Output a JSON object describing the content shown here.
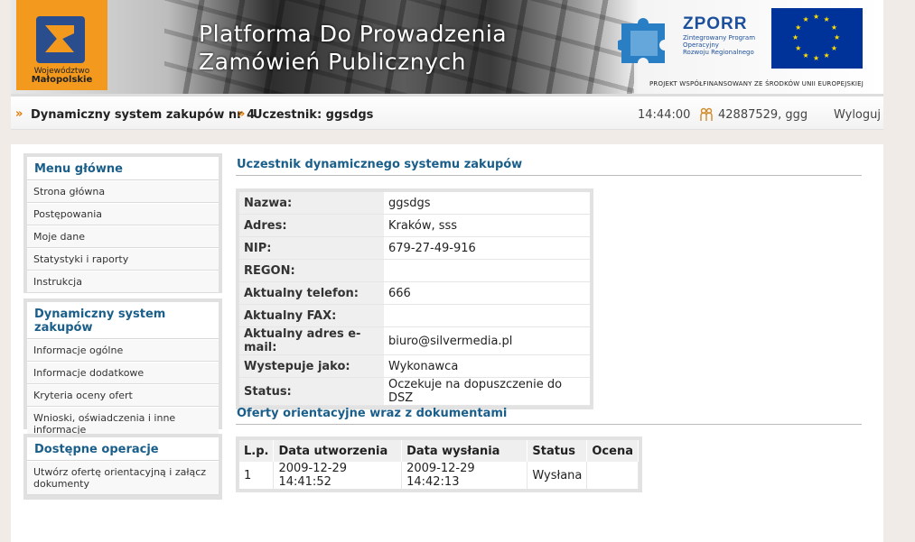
{
  "header": {
    "region_logo": {
      "line1": "Województwo",
      "line2": "Małopolskie"
    },
    "title_line1": "Platforma Do Prowadzenia",
    "title_line2": "Zamówień Publicznych",
    "zporr": {
      "name": "ZPORR",
      "line1": "Zintegrowany Program",
      "line2": "Operacyjny",
      "line3": "Rozwoju Regionalnego"
    },
    "project_note": "PROJEKT WSPÓŁFINANSOWANY ZE ŚRODKÓW UNII EUROPEJSKIEJ",
    "accent_color": "#f39a1e",
    "eu_flag_color": "#003399"
  },
  "navbar": {
    "breadcrumb_sep": "»",
    "crumb1": "Dynamiczny system zakupów nr 4",
    "crumb2": "Uczestnik: ggsdgs",
    "time": "14:44:00",
    "user_icon": "users-icon",
    "user": "42887529, ggg",
    "logout": "Wyloguj"
  },
  "sidebar": {
    "menu": {
      "title": "Menu główne",
      "items": [
        "Strona główna",
        "Postępowania",
        "Moje dane",
        "Statystyki i raporty",
        "Instrukcja"
      ]
    },
    "dsz": {
      "title": "Dynamiczny system zakupów",
      "items": [
        "Informacje ogólne",
        "Informacje dodatkowe",
        "Kryteria oceny ofert",
        "Wnioski, oświadczenia i inne informacje"
      ]
    },
    "ops": {
      "title": "Dostępne operacje",
      "items": [
        "Utwórz ofertę orientacyjną i załącz dokumenty"
      ]
    }
  },
  "main": {
    "participant_title": "Uczestnik dynamicznego systemu zakupów",
    "fields": [
      {
        "label": "Nazwa:",
        "value": "ggsdgs"
      },
      {
        "label": "Adres:",
        "value": "Kraków, sss"
      },
      {
        "label": "NIP:",
        "value": "679-27-49-916"
      },
      {
        "label": "REGON:",
        "value": ""
      },
      {
        "label": "Aktualny telefon:",
        "value": "666"
      },
      {
        "label": "Aktualny FAX:",
        "value": ""
      },
      {
        "label": "Aktualny adres e-mail:",
        "value": "biuro@silvermedia.pl"
      },
      {
        "label": "Wystepuje jako:",
        "value": "Wykonawca"
      },
      {
        "label": "Status:",
        "value": "Oczekuje na dopuszczenie do DSZ"
      }
    ],
    "offers_title": "Oferty orientacyjne wraz z dokumentami",
    "offers_columns": [
      "L.p.",
      "Data utworzenia",
      "Data wysłania",
      "Status",
      "Ocena"
    ],
    "offers_rows": [
      [
        "1",
        "2009-12-29 14:41:52",
        "2009-12-29 14:42:13",
        "Wysłana",
        ""
      ]
    ]
  }
}
